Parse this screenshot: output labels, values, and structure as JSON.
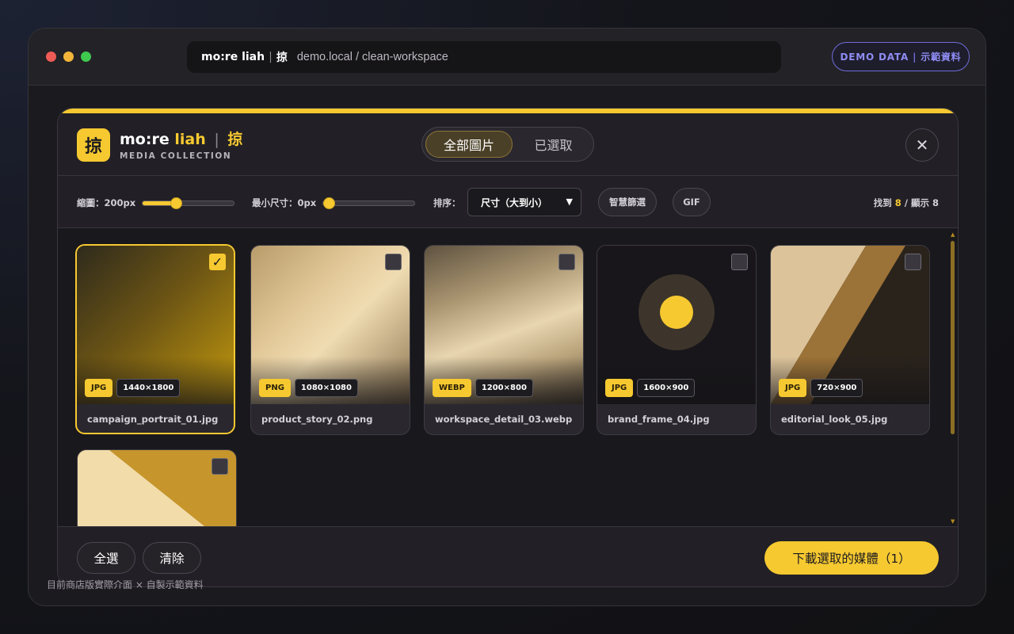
{
  "browser": {
    "url_brand": "mo:re liah",
    "url_brand_cjk": "掠",
    "url_sep": "|",
    "url_path": "demo.local / clean-workspace",
    "demo_label": "DEMO DATA",
    "demo_label_cjk": "示範資料",
    "demo_sep": "|"
  },
  "header": {
    "logo_glyph": "掠",
    "title_main": "mo:re",
    "title_accent": "liah",
    "title_sep": "|",
    "title_cjk": "掠",
    "subtitle": "MEDIA COLLECTION",
    "tabs": [
      {
        "label": "全部圖片",
        "active": true
      },
      {
        "label": "已選取",
        "active": false
      }
    ],
    "close_symbol": "✕"
  },
  "toolbar": {
    "thumb_label": "縮圖：200px",
    "thumb_slider_value": 0.35,
    "minsize_label": "最小尺寸：0px",
    "minsize_slider_value": 0.0,
    "sort_label": "排序：",
    "sort_value": "尺寸（大到小）",
    "smart_filter_label": "智慧篩選",
    "gif_label": "GIF",
    "found_prefix": "找到",
    "found_count": "8",
    "shown_prefix": "/ 顯示",
    "shown_count": "8"
  },
  "media": [
    {
      "name": "campaign_portrait_01.jpg",
      "format": "JPG",
      "dims": "1440×1800",
      "selected": true
    },
    {
      "name": "product_story_02.png",
      "format": "PNG",
      "dims": "1080×1080",
      "selected": false
    },
    {
      "name": "workspace_detail_03.webp",
      "format": "WEBP",
      "dims": "1200×800",
      "selected": false
    },
    {
      "name": "brand_frame_04.jpg",
      "format": "JPG",
      "dims": "1600×900",
      "selected": false
    },
    {
      "name": "editorial_look_05.jpg",
      "format": "JPG",
      "dims": "720×900",
      "selected": false
    },
    {
      "name": "",
      "format": "",
      "dims": "",
      "selected": false
    }
  ],
  "footer": {
    "select_all": "全選",
    "clear": "清除",
    "download": "下載選取的媒體（1）"
  },
  "caption": "目前商店版實際介面 × 自製示範資料",
  "colors": {
    "accent": "#f7c930",
    "demo_accent": "#8e8cf2",
    "background": "#19181c"
  }
}
